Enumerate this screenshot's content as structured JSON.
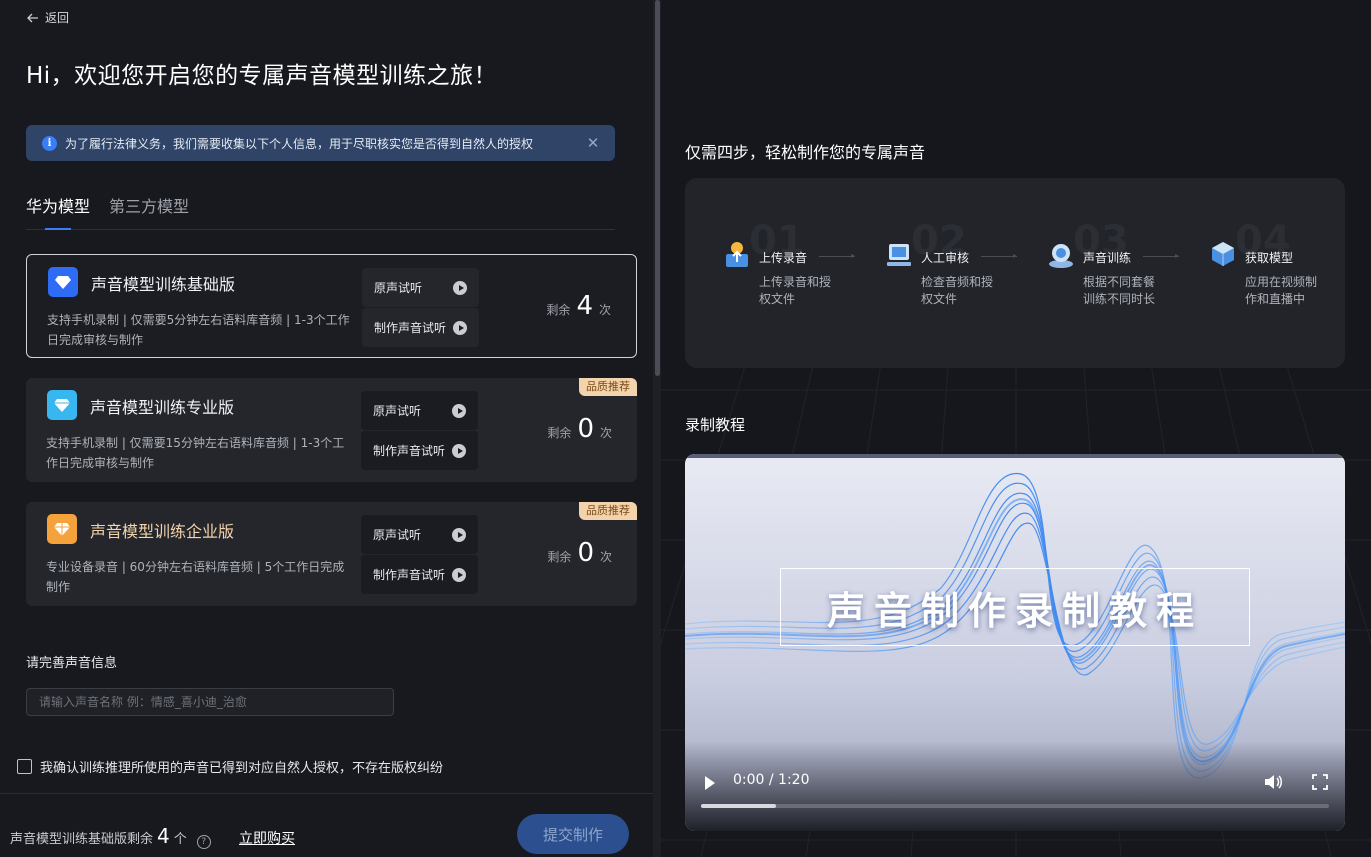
{
  "nav": {
    "back_label": "返回"
  },
  "headline": "Hi，欢迎您开启您的专属声音模型训练之旅！",
  "notice": {
    "text": "为了履行法律义务，我们需要收集以下个人信息，用于尽职核实您是否得到自然人的授权",
    "icon": "info-icon"
  },
  "tabs": [
    {
      "label": "华为模型",
      "active": true
    },
    {
      "label": "第三方模型",
      "active": false
    }
  ],
  "plans": [
    {
      "name": "声音模型训练基础版",
      "desc": "支持手机录制 | 仅需要5分钟左右语料库音频 | 1-3个工作日完成审核与制作",
      "btn_listen": "原声试听",
      "btn_make": "制作声音试听",
      "remain_label": "剩余",
      "remain_count": "4",
      "remain_unit": "次",
      "badge": "",
      "icon_color": "#2e6cf6",
      "selected": true
    },
    {
      "name": "声音模型训练专业版",
      "desc": "支持手机录制 | 仅需要15分钟左右语料库音频 | 1-3个工作日完成审核与制作",
      "btn_listen": "原声试听",
      "btn_make": "制作声音试听",
      "remain_label": "剩余",
      "remain_count": "0",
      "remain_unit": "次",
      "badge": "品质推荐",
      "icon_color": "#38b6f0",
      "selected": false
    },
    {
      "name": "声音模型训练企业版",
      "desc": "专业设备录音 | 60分钟左右语料库音频 | 5个工作日完成制作",
      "btn_listen": "原声试听",
      "btn_make": "制作声音试听",
      "remain_label": "剩余",
      "remain_count": "0",
      "remain_unit": "次",
      "badge": "品质推荐",
      "icon_color": "#f3a23c",
      "selected": false
    }
  ],
  "form": {
    "section_label": "请完善声音信息",
    "name_placeholder": "请输入声音名称 例：情感_喜小迪_治愈",
    "name_value": "",
    "consent_label": "我确认训练推理所使用的声音已得到对应自然人授权，不存在版权纠纷",
    "consent_checked": false
  },
  "footer": {
    "remain_prefix": "声音模型训练基础版剩余",
    "remain_count": "4",
    "remain_unit": "个",
    "help_icon": "question-icon",
    "buy_label": "立即购买",
    "submit_label": "提交制作"
  },
  "steps_section": {
    "title": "仅需四步，轻松制作您的专属声音",
    "steps": [
      {
        "num": "01",
        "title": "上传录音",
        "desc": "上传录音和授权文件",
        "icon": "upload-icon"
      },
      {
        "num": "02",
        "title": "人工审核",
        "desc": "检查音频和授权文件",
        "icon": "review-icon"
      },
      {
        "num": "03",
        "title": "声音训练",
        "desc": "根据不同套餐训练不同时长",
        "icon": "training-icon"
      },
      {
        "num": "04",
        "title": "获取模型",
        "desc": "应用在视频制作和直播中",
        "icon": "model-icon"
      }
    ]
  },
  "tutorial": {
    "title": "录制教程",
    "video_title": "声音制作录制教程",
    "time": "0:00 / 1:20",
    "progress_buffered": 0.12
  }
}
